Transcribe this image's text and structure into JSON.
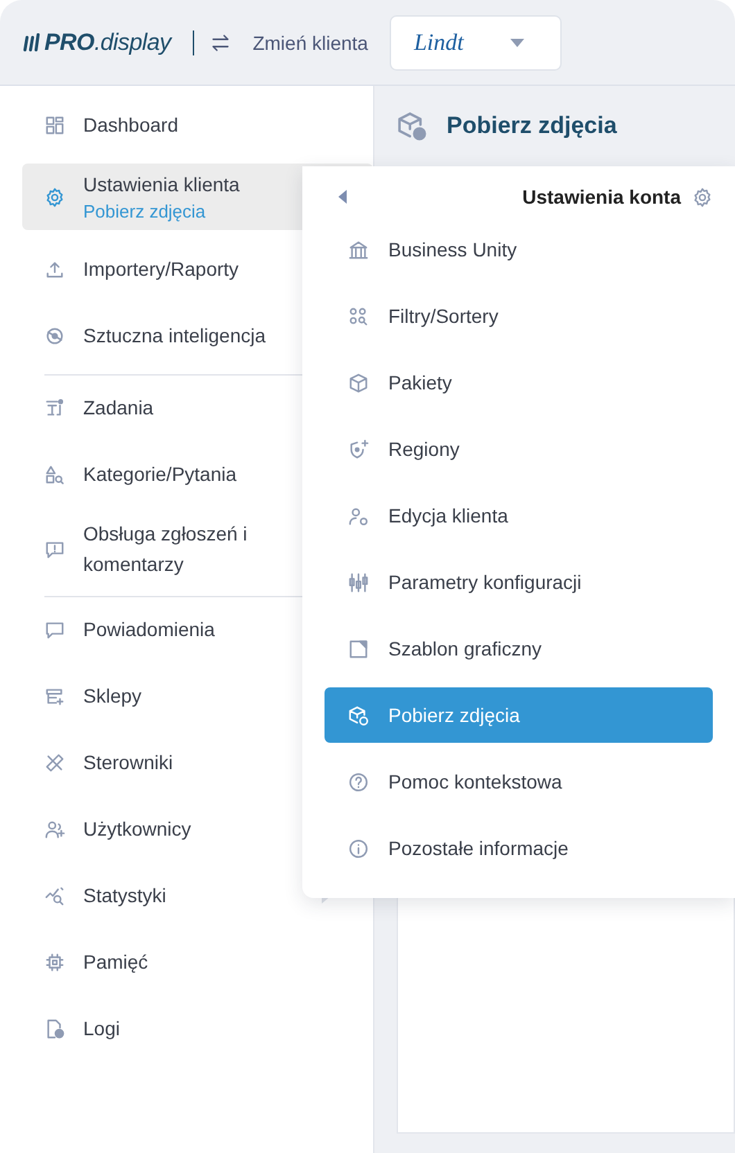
{
  "header": {
    "logo": "**PRO**.display",
    "switch_label": "Zmień klienta",
    "client": "Lindt"
  },
  "sidebar": {
    "sections": [
      {
        "items": [
          {
            "label": "Dashboard",
            "selected": false,
            "has_submenu": false
          },
          {
            "label": "Ustawienia klienta",
            "subtitle": "Pobierz zdjęcia",
            "selected": true,
            "has_submenu": false
          },
          {
            "label": "Importery/Raporty",
            "selected": false,
            "has_submenu": false
          },
          {
            "label": "Sztuczna inteligencja",
            "selected": false,
            "has_submenu": false
          }
        ]
      },
      {
        "items": [
          {
            "label": "Zadania",
            "selected": false,
            "has_submenu": false
          },
          {
            "label": "Kategorie/Pytania",
            "selected": false,
            "has_submenu": false
          },
          {
            "label": "Obsługa zgłoszeń i komentarzy",
            "selected": false,
            "has_submenu": false
          }
        ]
      },
      {
        "items": [
          {
            "label": "Powiadomienia",
            "selected": false,
            "has_submenu": false
          },
          {
            "label": "Sklepy",
            "selected": false,
            "has_submenu": false
          },
          {
            "label": "Sterowniki",
            "selected": false,
            "has_submenu": false
          },
          {
            "label": "Użytkownicy",
            "selected": false,
            "has_submenu": false
          },
          {
            "label": "Statystyki",
            "selected": false,
            "has_submenu": true
          },
          {
            "label": "Pamięć",
            "selected": false,
            "has_submenu": false
          },
          {
            "label": "Logi",
            "selected": false,
            "has_submenu": false
          }
        ]
      }
    ]
  },
  "page": {
    "title": "Pobierz zdjęcia"
  },
  "submenu": {
    "title": "Ustawienia konta",
    "items": [
      {
        "label": "Business Unity",
        "selected": false
      },
      {
        "label": "Filtry/Sortery",
        "selected": false
      },
      {
        "label": "Pakiety",
        "selected": false
      },
      {
        "label": "Regiony",
        "selected": false
      },
      {
        "label": "Edycja klienta",
        "selected": false
      },
      {
        "label": "Parametry konfiguracji",
        "selected": false
      },
      {
        "label": "Szablon graficzny",
        "selected": false
      },
      {
        "label": "Pobierz zdjęcia",
        "selected": true
      },
      {
        "label": "Pomoc kontekstowa",
        "selected": false
      },
      {
        "label": "Pozostałe informacje",
        "selected": false
      }
    ]
  }
}
